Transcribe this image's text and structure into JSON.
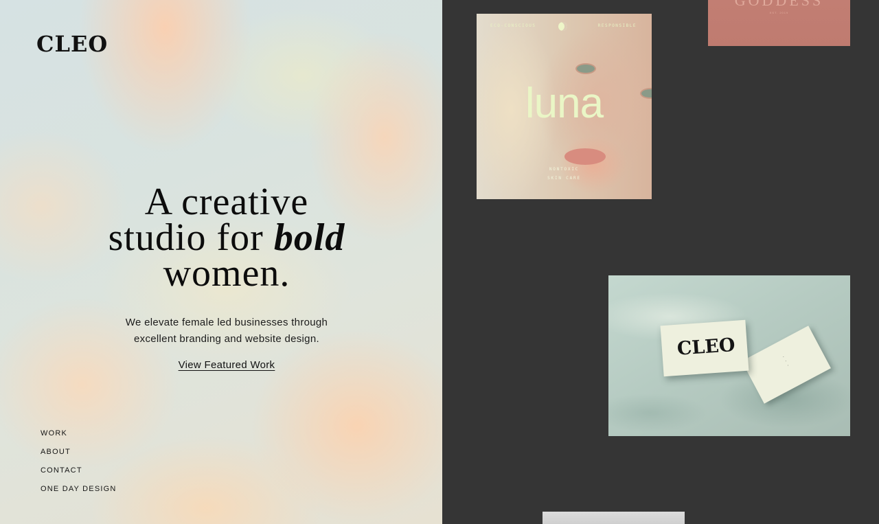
{
  "brand": {
    "logo": "CLEO"
  },
  "hero": {
    "line1": "A creative",
    "line2_pre": "studio for ",
    "line2_em": "bold",
    "line3": "women.",
    "subtitle_line1": "We elevate female led businesses through",
    "subtitle_line2": "excellent branding and website design.",
    "cta": "View Featured Work"
  },
  "nav": {
    "items": [
      "WORK",
      "ABOUT",
      "CONTACT",
      "ONE DAY DESIGN"
    ]
  },
  "portfolio": {
    "luna": {
      "top_left": "ECO-CONSCIOUS",
      "top_right": "RESPONSIBLE",
      "wordmark": "luna",
      "tag_line1": "NONTOXIC",
      "tag_line2": "SKIN CARE"
    },
    "goddess": {
      "wordmark": "GODDESS",
      "sub": "EST. 2019"
    },
    "business_card": {
      "logo": "CLEO"
    }
  },
  "colors": {
    "right_background": "#353535",
    "text": "#111111",
    "luna_accent": "#eaf6c6",
    "goddess_card": "#c27e73",
    "business_card_bg": "#b6cbc2"
  }
}
